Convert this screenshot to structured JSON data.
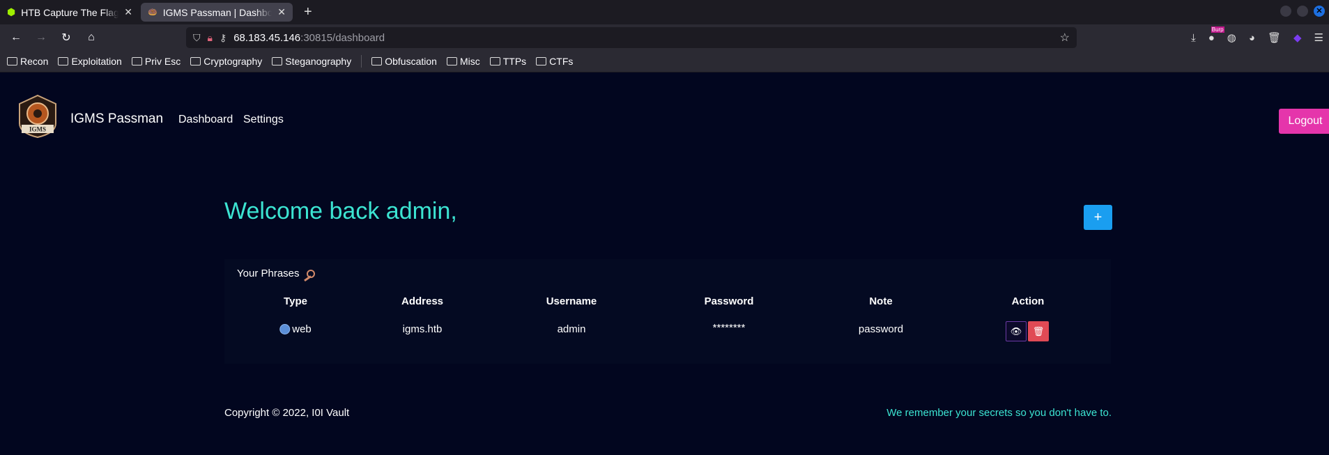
{
  "browser": {
    "tabs": [
      {
        "title": "HTB Capture The Flag Pla",
        "active": false
      },
      {
        "title": "IGMS Passman | Dashboa",
        "active": true
      }
    ],
    "url_host": "68.183.45.146",
    "url_path": ":30815/dashboard",
    "bookmarks": [
      "Recon",
      "Exploitation",
      "Priv Esc",
      "Cryptography",
      "Steganography",
      "Obfuscation",
      "Misc",
      "TTPs",
      "CTFs"
    ],
    "extension_badge": "Burp"
  },
  "header": {
    "logo_text": "IGMS",
    "brand": "IGMS Passman",
    "nav": [
      "Dashboard",
      "Settings"
    ],
    "logout_label": "Logout"
  },
  "main": {
    "welcome": "Welcome back admin,",
    "add_label": "+",
    "card_title": "Your Phrases",
    "columns": [
      "Type",
      "Address",
      "Username",
      "Password",
      "Note",
      "Action"
    ],
    "rows": [
      {
        "type": "web",
        "address": "igms.htb",
        "username": "admin",
        "password": "********",
        "note": "password"
      }
    ]
  },
  "footer": {
    "copyright": "Copyright © 2022, I0I Vault",
    "tagline": "We remember your secrets so you don't have to."
  }
}
